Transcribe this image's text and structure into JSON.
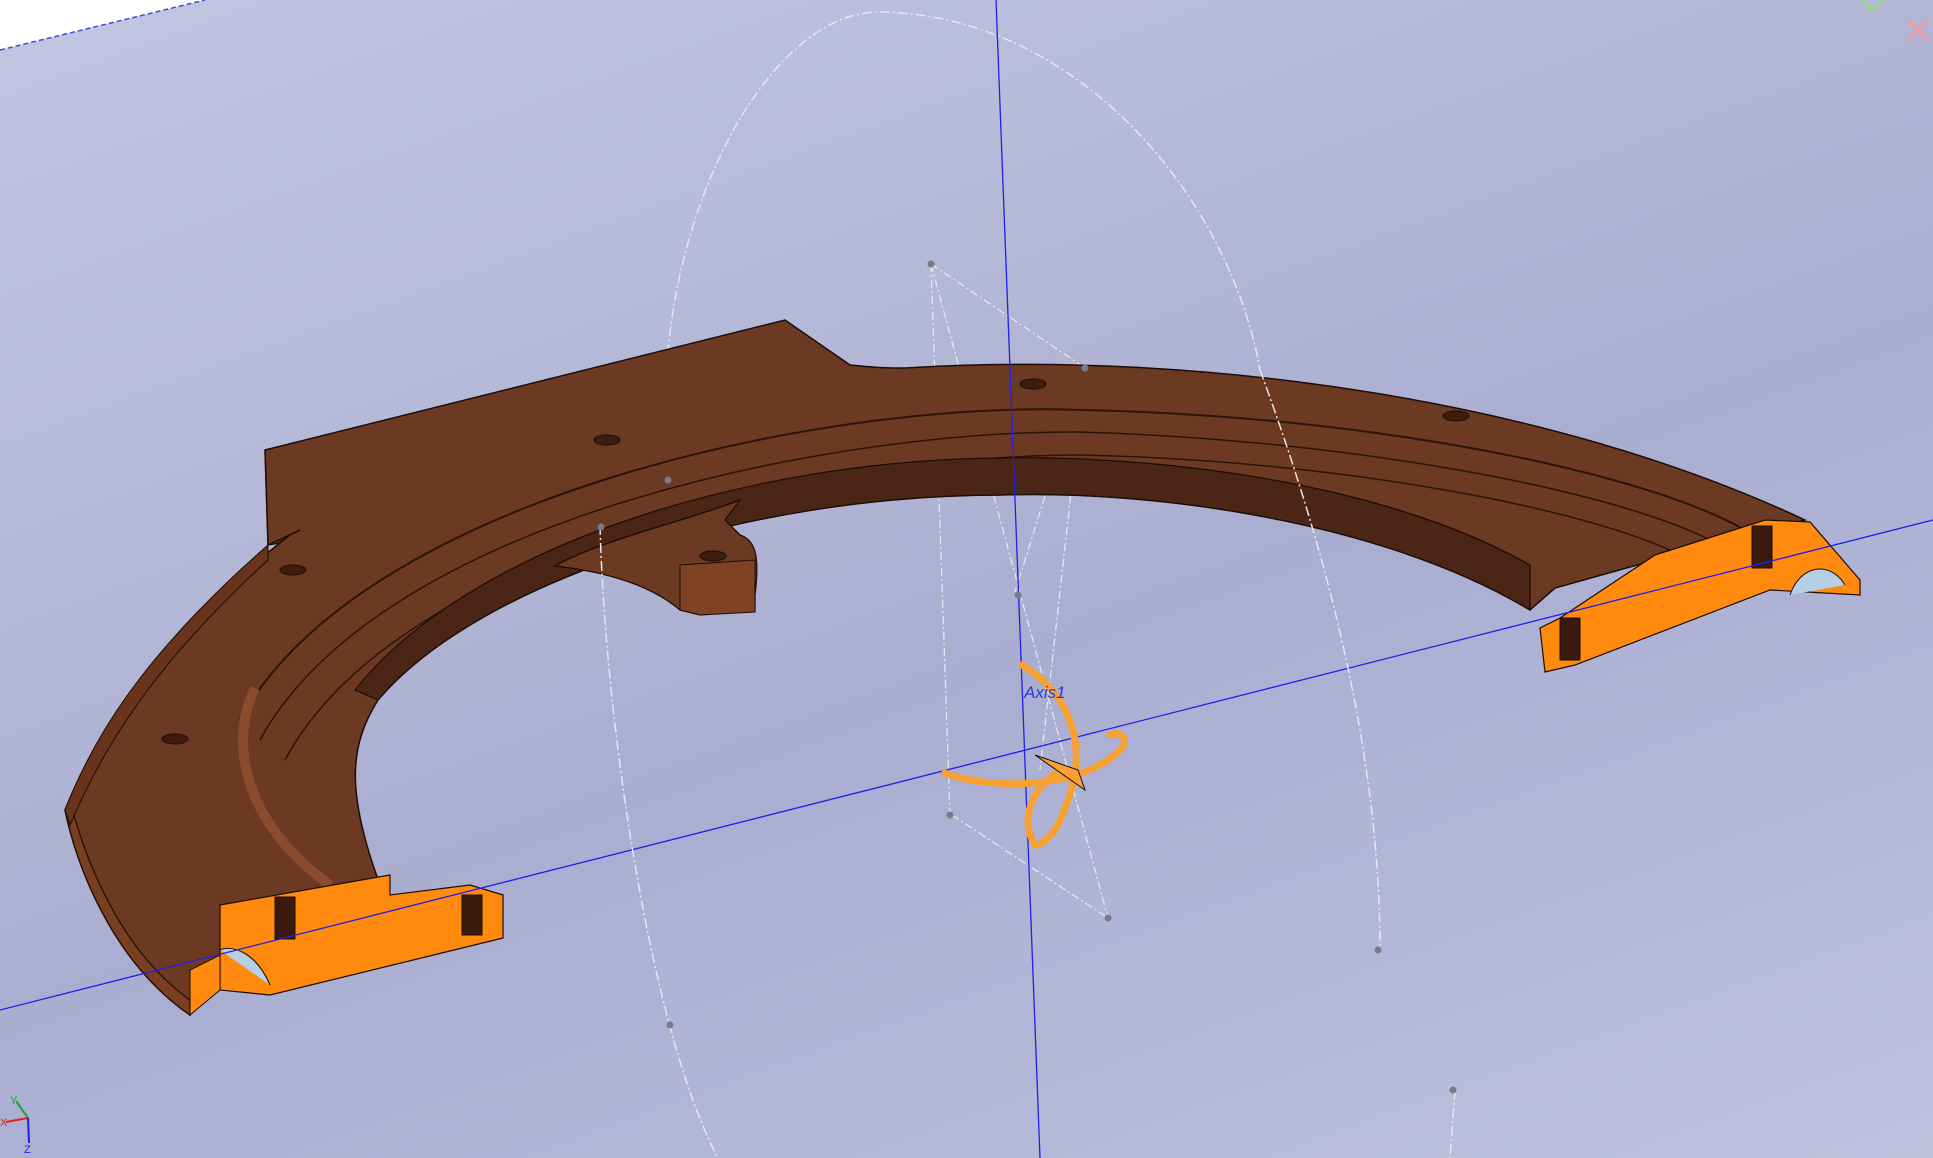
{
  "viewport": {
    "axis_label": "Axis1",
    "triad": {
      "x_label": "X",
      "y_label": "Y",
      "z_label": "Z"
    },
    "confirm_icon": "check-icon",
    "cancel_icon": "close-icon",
    "colors": {
      "part_body": "#6b3a22",
      "part_shadow": "#4a2415",
      "part_section": "#ff8a0d",
      "axis_line": "#2020e8",
      "rotate_handle": "#f7a133"
    }
  }
}
